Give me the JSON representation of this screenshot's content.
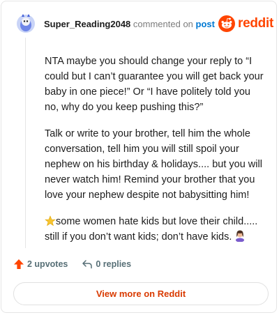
{
  "header": {
    "username": "Super_Reading2048",
    "action_text": "commented on",
    "post_link": "post",
    "brand": "reddit"
  },
  "comment": {
    "paragraphs": [
      "NTA maybe you should change your reply to “I could but I can’t guarantee you will get back your baby in one piece!” Or “I have politely told you no, why do you keep pushing this?”",
      "Talk or write to your brother, tell him the whole conversation, tell him you will still spoil your nephew on his birthday & holidays.... but you will never watch him! Remind your brother that you love your nephew despite not babysitting him!",
      "some women hate kids but love their child..... still if you don’t want kids; don’t have kids. "
    ]
  },
  "actions": {
    "upvotes": "2 upvotes",
    "replies": "0 replies"
  },
  "footer": {
    "view_more": "View more on Reddit"
  },
  "colors": {
    "brand": "#ff4500",
    "link": "#0079d3",
    "upvote": "#ff4500",
    "view_more": "#d93a00"
  },
  "icons": [
    "user-avatar-icon",
    "reddit-snoo-icon",
    "star-emoji-icon",
    "woman-facepalming-emoji-icon",
    "upvote-arrow-icon",
    "reply-arrow-icon"
  ]
}
